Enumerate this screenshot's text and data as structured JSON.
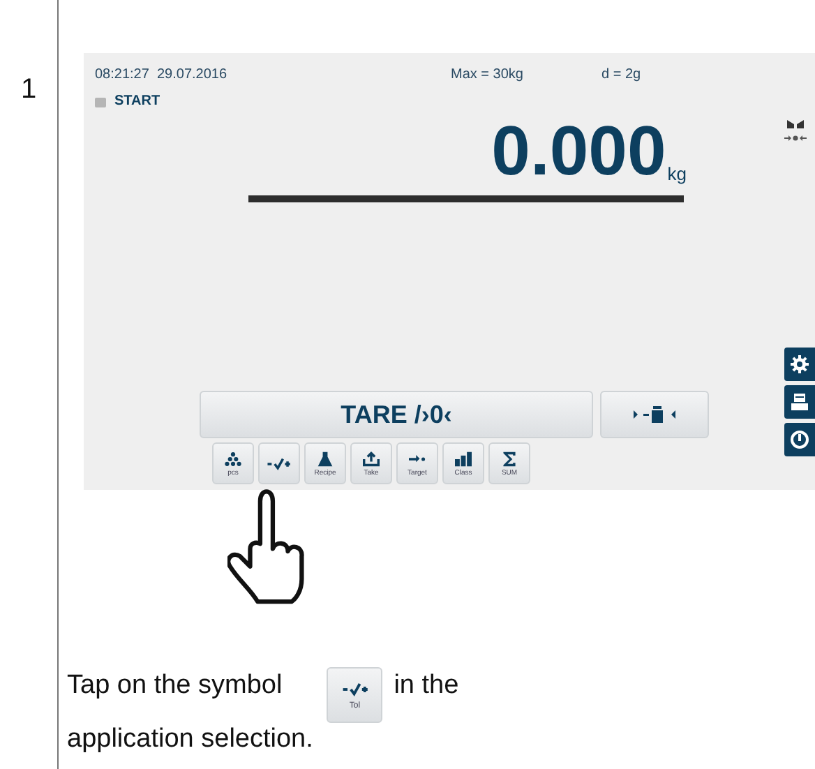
{
  "step": "1",
  "screen": {
    "time": "08:21:27",
    "date": "29.07.2016",
    "max": "Max = 30kg",
    "division": "d = 2g",
    "status": "START",
    "weight": "0.000",
    "unit": "kg",
    "tare_button": "TARE /›0‹",
    "apps": [
      {
        "kind": "pcs",
        "label": "pcs"
      },
      {
        "kind": "tol"
      },
      {
        "kind": "recipe",
        "label": "Recipe"
      },
      {
        "kind": "take",
        "label": "Take"
      },
      {
        "kind": "target",
        "label": "Target"
      },
      {
        "kind": "class",
        "label": "Class"
      },
      {
        "kind": "sum",
        "label": "SUM"
      }
    ]
  },
  "instruction": {
    "before": "Tap on the symbol",
    "button": {
      "kind": "tol",
      "label": "Tol"
    },
    "after": "in the application selection."
  }
}
